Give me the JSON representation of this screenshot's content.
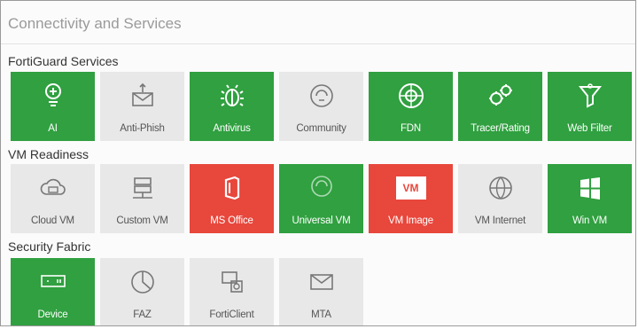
{
  "panel": {
    "title": "Connectivity and Services"
  },
  "sections": {
    "fortiguard": {
      "label": "FortiGuard Services",
      "tiles": [
        {
          "label": "AI",
          "status": "green",
          "icon": "ai-brain-icon"
        },
        {
          "label": "Anti-Phish",
          "status": "grey",
          "icon": "fish-hook-icon"
        },
        {
          "label": "Antivirus",
          "status": "green",
          "icon": "bug-icon"
        },
        {
          "label": "Community",
          "status": "grey",
          "icon": "community-icon"
        },
        {
          "label": "FDN",
          "status": "green",
          "icon": "globe-icon"
        },
        {
          "label": "Tracer/Rating",
          "status": "green",
          "icon": "gears-icon"
        },
        {
          "label": "Web Filter",
          "status": "green",
          "icon": "funnel-icon"
        }
      ]
    },
    "vm": {
      "label": "VM Readiness",
      "tiles": [
        {
          "label": "Cloud VM",
          "status": "grey",
          "icon": "cloud-icon"
        },
        {
          "label": "Custom VM",
          "status": "grey",
          "icon": "server-icon"
        },
        {
          "label": "MS Office",
          "status": "red",
          "icon": "office-icon"
        },
        {
          "label": "Universal VM",
          "status": "green",
          "icon": "universal-vm-icon"
        },
        {
          "label": "VM Image",
          "status": "red",
          "icon": "vm-image-icon",
          "badge": "VM"
        },
        {
          "label": "VM Internet",
          "status": "grey",
          "icon": "globe-internet-icon"
        },
        {
          "label": "Win VM",
          "status": "green",
          "icon": "windows-icon"
        }
      ]
    },
    "fabric": {
      "label": "Security Fabric",
      "tiles": [
        {
          "label": "Device",
          "status": "green",
          "icon": "device-icon"
        },
        {
          "label": "FAZ",
          "status": "grey",
          "icon": "pie-chart-icon"
        },
        {
          "label": "FortiClient",
          "status": "grey",
          "icon": "forticlient-icon"
        },
        {
          "label": "MTA",
          "status": "grey",
          "icon": "envelope-icon"
        }
      ]
    }
  },
  "colors": {
    "green": "#30a040",
    "grey": "#e8e8e8",
    "red": "#e8473c"
  }
}
